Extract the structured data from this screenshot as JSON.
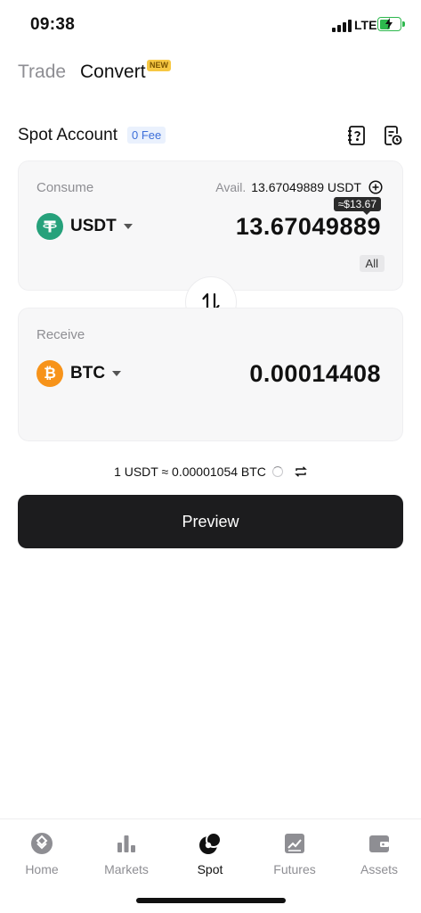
{
  "status_bar": {
    "time": "09:38",
    "network": "LTE"
  },
  "tabs": {
    "trade": "Trade",
    "convert": "Convert",
    "new_badge": "NEW"
  },
  "account": {
    "title": "Spot Account",
    "fee_badge": "0 Fee"
  },
  "consume": {
    "label": "Consume",
    "avail_label": "Avail.",
    "avail_value": "13.67049889 USDT",
    "usd_estimate": "≈$13.67",
    "coin": "USDT",
    "amount": "13.67049889",
    "all_label": "All"
  },
  "receive": {
    "label": "Receive",
    "coin": "BTC",
    "amount": "0.00014408"
  },
  "rate": {
    "text": "1 USDT ≈ 0.00001054 BTC"
  },
  "preview_label": "Preview",
  "nav": {
    "items": [
      {
        "label": "Home",
        "icon": "home-icon"
      },
      {
        "label": "Markets",
        "icon": "markets-icon"
      },
      {
        "label": "Spot",
        "icon": "spot-icon"
      },
      {
        "label": "Futures",
        "icon": "futures-icon"
      },
      {
        "label": "Assets",
        "icon": "assets-icon"
      }
    ],
    "active": "Spot"
  },
  "colors": {
    "usdt": "#26a17b",
    "btc": "#f7931a",
    "new_badge": "#f7c843",
    "fee_badge_text": "#3d6fd9",
    "primary_button": "#1c1c1e"
  }
}
